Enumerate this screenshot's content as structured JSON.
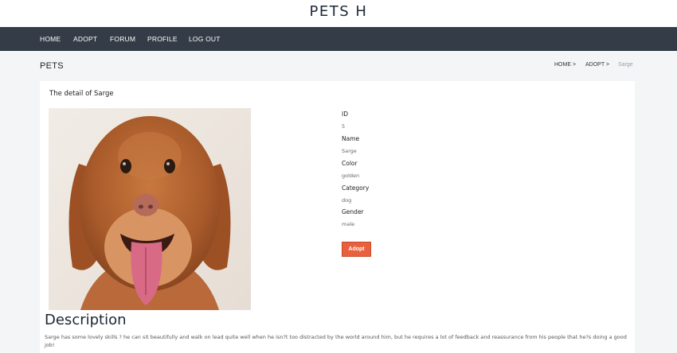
{
  "brand": {
    "title": "PETS H"
  },
  "nav": {
    "items": [
      {
        "label": "HOME"
      },
      {
        "label": "ADOPT"
      },
      {
        "label": "FORUM"
      },
      {
        "label": "PROFILE"
      },
      {
        "label": "LOG OUT"
      }
    ]
  },
  "header": {
    "title": "PETS",
    "breadcrumb": [
      {
        "label": "HOME >"
      },
      {
        "label": "ADOPT >"
      },
      {
        "label": "Sarge"
      }
    ]
  },
  "detail": {
    "heading": "The detail of Sarge",
    "fields": [
      {
        "label": "ID",
        "value": "5"
      },
      {
        "label": "Name",
        "value": "Sarge"
      },
      {
        "label": "Color",
        "value": "golden"
      },
      {
        "label": "Category",
        "value": "dog"
      },
      {
        "label": "Gender",
        "value": "male"
      }
    ],
    "adopt_label": "Adopt"
  },
  "description": {
    "title": "Description",
    "text": "Sarge has some lovely skills ? he can sit beautifully and walk on lead quite well when he isn?t too distracted by the world around him, but he requires a lot of feedback and reassurance from his people that he?s doing a good job!"
  },
  "colors": {
    "nav_bg": "#343d47",
    "accent": "#e8603c",
    "page_bg": "#f4f5f7"
  },
  "icons": {
    "photo": "dog-photo"
  }
}
